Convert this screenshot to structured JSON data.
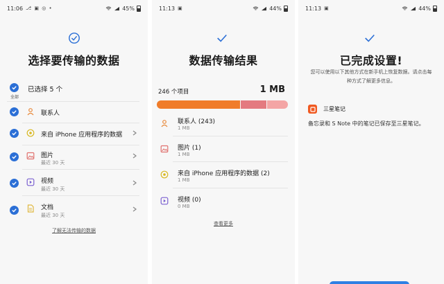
{
  "status": {
    "p1_time": "11:06",
    "p1_notifs": "⎇ ▣ ◎ •",
    "p1_battery": "45%",
    "p2_time": "11:13",
    "p2_notifs": "▣",
    "p2_battery": "44%",
    "p3_time": "11:13",
    "p3_notifs": "▣",
    "p3_battery": "44%"
  },
  "select_screen": {
    "title": "选择要传输的数据",
    "select_all_text": "已选择 5 个",
    "select_all_label": "全部",
    "items": [
      {
        "label": "联系人",
        "sub": "",
        "icon": "person-icon",
        "has_chevron": false
      },
      {
        "label": "来自 iPhone 应用程序的数据",
        "sub": "",
        "icon": "app-data-icon",
        "has_chevron": true
      },
      {
        "label": "图片",
        "sub": "最近 30 天",
        "icon": "image-icon",
        "has_chevron": true
      },
      {
        "label": "视频",
        "sub": "最近 30 天",
        "icon": "video-icon",
        "has_chevron": true
      },
      {
        "label": "文档",
        "sub": "最近 30 天",
        "icon": "document-icon",
        "has_chevron": true
      }
    ],
    "link": "了解无法传输的数据"
  },
  "result_screen": {
    "title": "数据传输结果",
    "count": "246 个项目",
    "size": "1 MB",
    "bar_segments": [
      {
        "fraction": 0.64,
        "color": "#f07c2a"
      },
      {
        "fraction": 0.2,
        "color": "#e47a80"
      },
      {
        "fraction": 0.16,
        "color": "#f4a5a5"
      }
    ],
    "items": [
      {
        "label": "联系人 (243)",
        "sub": "1 MB",
        "icon": "person-icon"
      },
      {
        "label": "图片 (1)",
        "sub": "1 MB",
        "icon": "image-icon"
      },
      {
        "label": "来自 iPhone 应用程序的数据 (2)",
        "sub": "1 MB",
        "icon": "app-data-icon"
      },
      {
        "label": "视频 (0)",
        "sub": "0 MB",
        "icon": "video-icon"
      }
    ],
    "more_link": "查看更多"
  },
  "done_screen": {
    "title": "已完成设置!",
    "description_line1": "您可以使用以下其他方式在新手机上恢复数据。请点击每",
    "description_line2": "种方式了解更多信息。",
    "app_name": "三星笔记",
    "app_icon": "samsung-notes-icon",
    "app_desc": "备忘录和 S Note 中的笔记已保存至三星笔记。"
  },
  "colors": {
    "accent": "#2b6fd6",
    "person": "#e88a3c",
    "app_data": "#d8b820",
    "image": "#e0716e",
    "video": "#7a5fd0",
    "document": "#e0b840"
  }
}
